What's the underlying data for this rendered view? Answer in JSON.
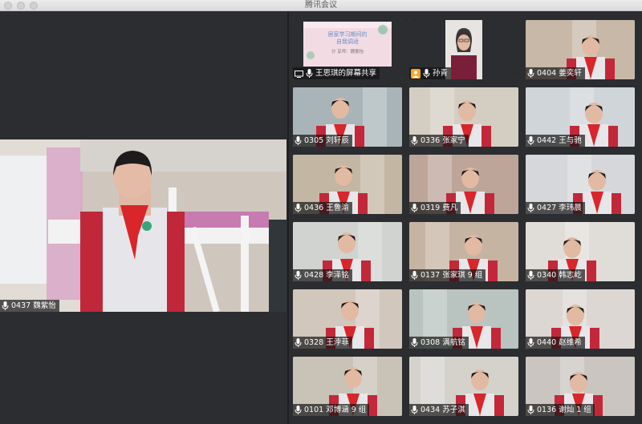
{
  "window": {
    "title": "腾讯会议"
  },
  "main": {
    "speaker_name": "0437 魏紫怡"
  },
  "tiles": [
    {
      "name": "王思琪的屏幕共享",
      "kind": "share",
      "slide": {
        "line1": "居家学习期间的",
        "line2": "自我调适",
        "line3": "分 享师：魏紫怡"
      }
    },
    {
      "name": "孙青",
      "kind": "host"
    },
    {
      "name": "0404 姜奕轩",
      "kind": "student"
    },
    {
      "name": "0305 刘轩辰",
      "kind": "student"
    },
    {
      "name": "0336 张家宁",
      "kind": "student"
    },
    {
      "name": "0442 王与驰",
      "kind": "student"
    },
    {
      "name": "0436 王鲁渝",
      "kind": "student"
    },
    {
      "name": "0319 费凡",
      "kind": "student"
    },
    {
      "name": "0427 李玮晨",
      "kind": "student"
    },
    {
      "name": "0428 李泽铭",
      "kind": "student"
    },
    {
      "name": "0137 张家琪 9 组",
      "kind": "student"
    },
    {
      "name": "0340 韩志屹",
      "kind": "student"
    },
    {
      "name": "0328 王浡菲",
      "kind": "student"
    },
    {
      "name": "0308 满航铭",
      "kind": "student"
    },
    {
      "name": "0440 赵维希",
      "kind": "student"
    },
    {
      "name": "0101 邓博涵 9 组",
      "kind": "student"
    },
    {
      "name": "0434 苏子淇",
      "kind": "student"
    },
    {
      "name": "0136 谢灿 1 组",
      "kind": "student"
    }
  ],
  "colors": {
    "scarf": "#d8262b",
    "uniform_sleeve": "#c2283a",
    "uniform_body": "#e7e7ea",
    "accent_host": "#f5a623"
  }
}
